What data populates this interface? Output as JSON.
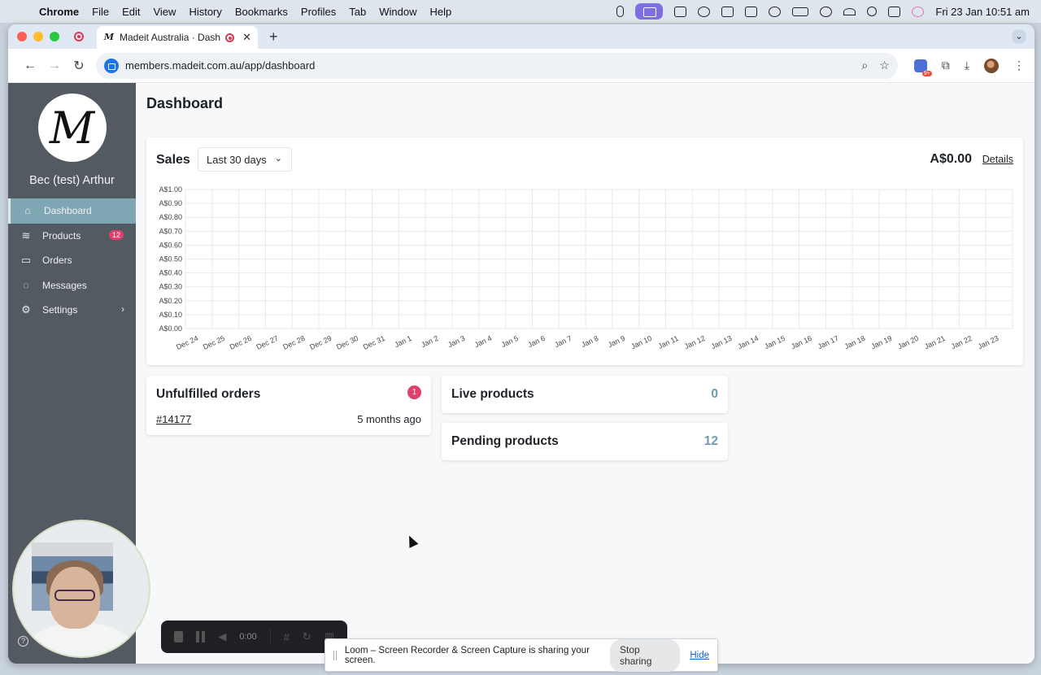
{
  "menubar": {
    "app": "Chrome",
    "items": [
      "File",
      "Edit",
      "View",
      "History",
      "Bookmarks",
      "Profiles",
      "Tab",
      "Window",
      "Help"
    ],
    "clock": "Fri 23 Jan  10:51 am"
  },
  "browser": {
    "tab_title": "Madeit Australia · Dashbo",
    "url": "members.madeit.com.au/app/dashboard",
    "extension_badge": "9+"
  },
  "sidebar": {
    "logo_letter": "M",
    "user_name": "Bec (test) Arthur",
    "items": [
      {
        "label": "Dashboard",
        "icon": "home-icon",
        "active": true
      },
      {
        "label": "Products",
        "icon": "layers-icon",
        "badge": "12"
      },
      {
        "label": "Orders",
        "icon": "book-icon"
      },
      {
        "label": "Messages",
        "icon": "chat-icon"
      },
      {
        "label": "Settings",
        "icon": "gear-icon"
      }
    ],
    "help_glyph": "?"
  },
  "main": {
    "page_title": "Dashboard",
    "sales": {
      "label": "Sales",
      "range": "Last 30 days",
      "total": "A$0.00",
      "details": "Details"
    },
    "unfulfilled": {
      "title": "Unfulfilled orders",
      "badge": "1",
      "order_id": "#14177",
      "order_time": "5 months ago"
    },
    "live_products": {
      "label": "Live products",
      "value": "0"
    },
    "pending_products": {
      "label": "Pending products",
      "value": "12"
    }
  },
  "chart_data": {
    "type": "line",
    "title": "",
    "xlabel": "",
    "ylabel": "",
    "y_ticks": [
      "A$0.00",
      "A$0.10",
      "A$0.20",
      "A$0.30",
      "A$0.40",
      "A$0.50",
      "A$0.60",
      "A$0.70",
      "A$0.80",
      "A$0.90",
      "A$1.00"
    ],
    "ylim": [
      0,
      1
    ],
    "categories": [
      "Dec 24",
      "Dec 25",
      "Dec 26",
      "Dec 27",
      "Dec 28",
      "Dec 29",
      "Dec 30",
      "Dec 31",
      "Jan 1",
      "Jan 2",
      "Jan 3",
      "Jan 4",
      "Jan 5",
      "Jan 6",
      "Jan 7",
      "Jan 8",
      "Jan 9",
      "Jan 10",
      "Jan 11",
      "Jan 12",
      "Jan 13",
      "Jan 14",
      "Jan 15",
      "Jan 16",
      "Jan 17",
      "Jan 18",
      "Jan 19",
      "Jan 20",
      "Jan 21",
      "Jan 22",
      "Jan 23"
    ],
    "values": [
      0,
      0,
      0,
      0,
      0,
      0,
      0,
      0,
      0,
      0,
      0,
      0,
      0,
      0,
      0,
      0,
      0,
      0,
      0,
      0,
      0,
      0,
      0,
      0,
      0,
      0,
      0,
      0,
      0,
      0,
      0
    ],
    "grid": true
  },
  "loom": {
    "timer": "0:00",
    "share_message": "Loom – Screen Recorder & Screen Capture is sharing your screen.",
    "stop_label": "Stop sharing",
    "hide_label": "Hide"
  }
}
